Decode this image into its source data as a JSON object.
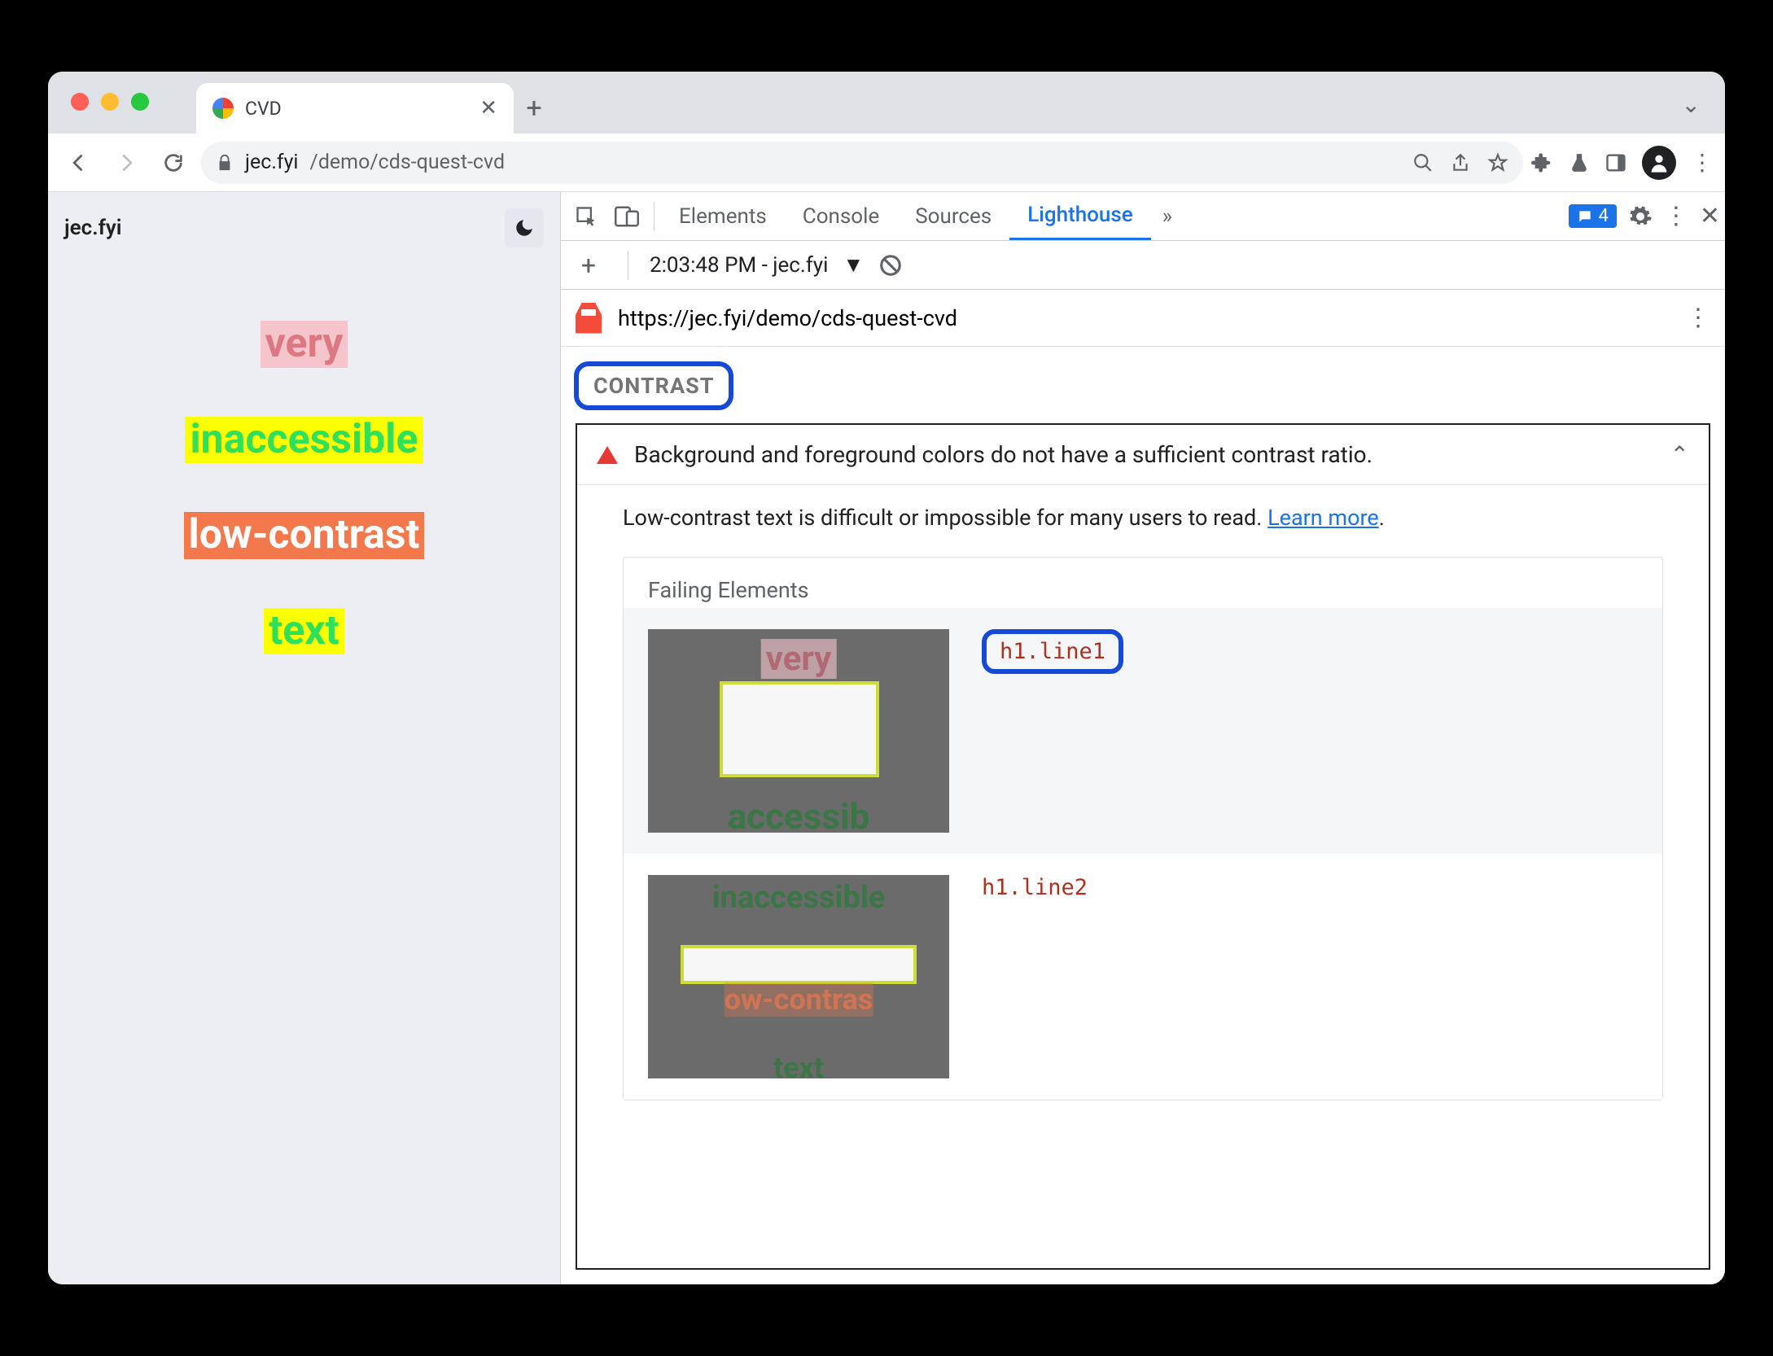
{
  "browser": {
    "tab_title": "CVD",
    "url_host": "jec.fyi",
    "url_path": "/demo/cds-quest-cvd"
  },
  "page": {
    "site_label": "jec.fyi",
    "words": {
      "w1": "very",
      "w2": "inaccessible",
      "w3": "low-contrast",
      "w4": "text"
    }
  },
  "devtools": {
    "tabs": {
      "elements": "Elements",
      "console": "Console",
      "sources": "Sources",
      "lighthouse": "Lighthouse"
    },
    "more_tabs_glyph": "»",
    "issues_count": "4",
    "run_label": "2:03:48 PM - jec.fyi",
    "report_url": "https://jec.fyi/demo/cds-quest-cvd",
    "section": "CONTRAST",
    "audit_title": "Background and foreground colors do not have a sufficient contrast ratio.",
    "audit_desc": "Low-contrast text is difficult or impossible for many users to read. ",
    "learn_more": "Learn more",
    "period": ".",
    "failing_label": "Failing Elements",
    "rows": [
      {
        "selector": "h1.line1"
      },
      {
        "selector": "h1.line2"
      }
    ]
  }
}
